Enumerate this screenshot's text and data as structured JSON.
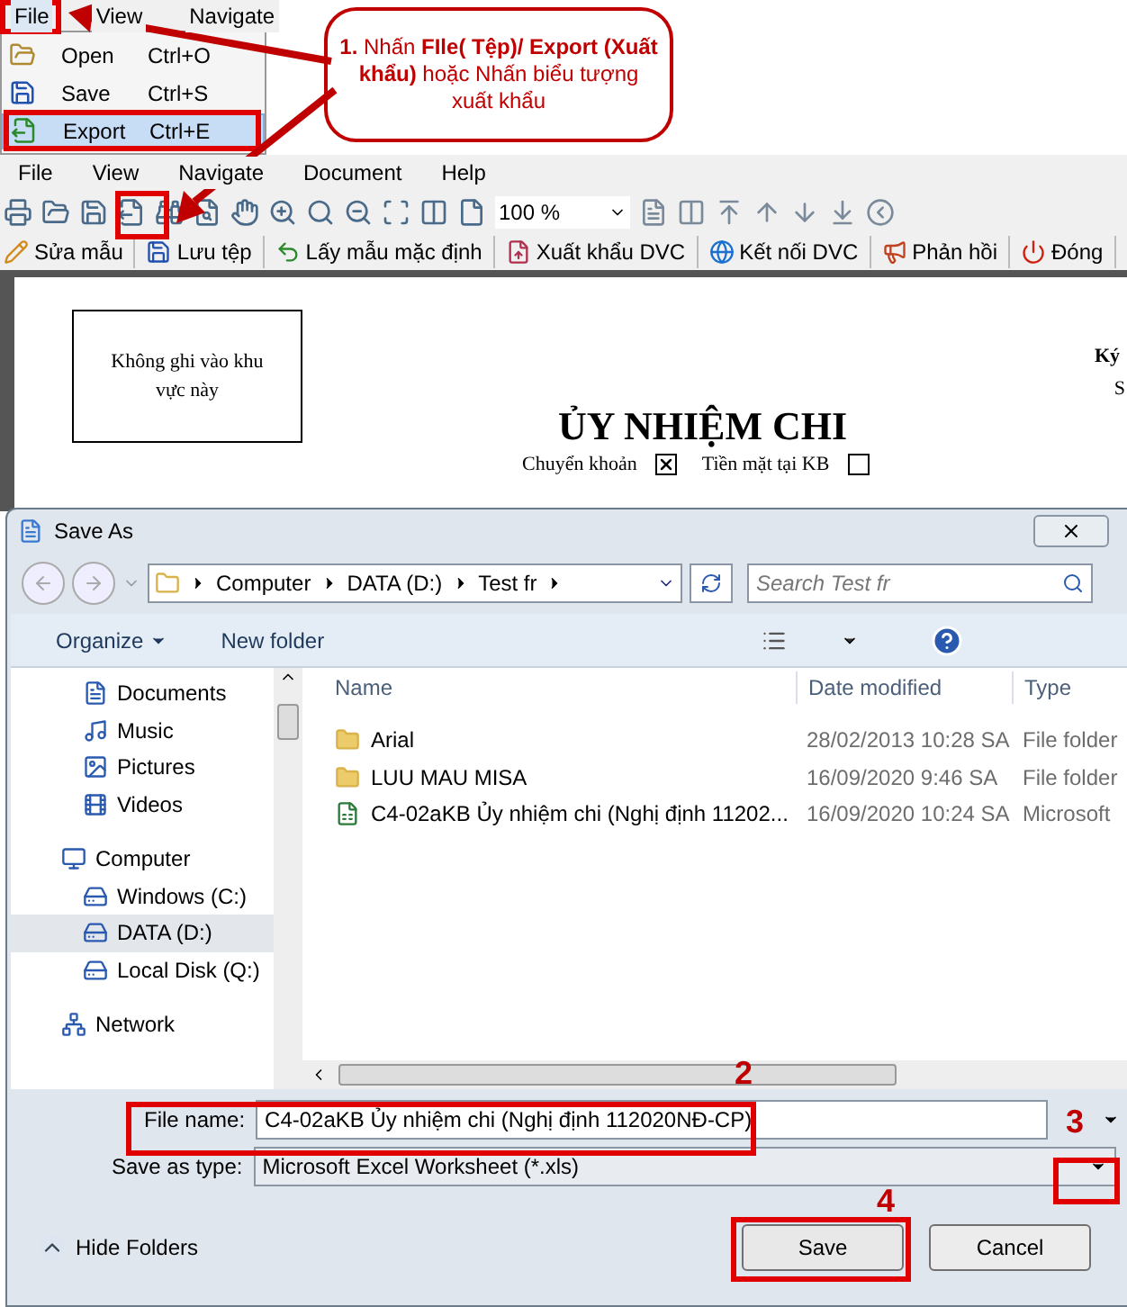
{
  "top_menu": {
    "items": [
      {
        "label": "File",
        "selected": true
      },
      {
        "label": "View",
        "selected": false
      },
      {
        "label": "Navigate",
        "selected": false
      }
    ],
    "dropdown": [
      {
        "label": "Open",
        "shortcut": "Ctrl+O",
        "selected": false
      },
      {
        "label": "Save",
        "shortcut": "Ctrl+S",
        "selected": false
      },
      {
        "label": "Export",
        "shortcut": "Ctrl+E",
        "selected": true
      }
    ]
  },
  "callout": "**1.** Nhấn **FIle( Tệp)/ Export (Xuất khẩu)** hoặc Nhấn biểu tượng xuất khẩu",
  "menu_bar": [
    "File",
    "View",
    "Navigate",
    "Document",
    "Help"
  ],
  "toolbar": {
    "zoom": "100 %"
  },
  "action_bar": [
    "Sửa mẫu",
    "Lưu tệp",
    "Lấy mẫu mặc định",
    "Xuất khẩu DVC",
    "Kết nối DVC",
    "Phản hồi",
    "Đóng"
  ],
  "document": {
    "note": "Không ghi vào khu vực này",
    "title": "ỦY NHIỆM CHI",
    "options": [
      {
        "label": "Chuyển khoản",
        "checked": true
      },
      {
        "label": "Tiền mặt tại KB",
        "checked": false
      }
    ],
    "right_texts": [
      "Ký",
      "S"
    ]
  },
  "dialog": {
    "title": "Save As",
    "breadcrumb": [
      "Computer",
      "DATA (D:)",
      "Test fr"
    ],
    "search": {
      "placeholder": "Search Test fr"
    },
    "commands": [
      "Organize",
      "New folder"
    ],
    "nav": [
      {
        "label": "Documents",
        "kind": "item",
        "selected": false
      },
      {
        "label": "Music",
        "kind": "item",
        "selected": false
      },
      {
        "label": "Pictures",
        "kind": "item",
        "selected": false
      },
      {
        "label": "Videos",
        "kind": "item",
        "selected": false
      },
      {
        "label": "Computer",
        "kind": "group",
        "selected": false
      },
      {
        "label": "Windows (C:)",
        "kind": "item",
        "selected": false
      },
      {
        "label": "DATA (D:)",
        "kind": "item",
        "selected": true
      },
      {
        "label": "Local Disk (Q:)",
        "kind": "item",
        "selected": false
      },
      {
        "label": "Network",
        "kind": "group",
        "selected": false
      }
    ],
    "columns": [
      "Name",
      "Date modified",
      "Type"
    ],
    "rows": [
      {
        "kind": "folder",
        "name": "Arial",
        "date": "28/02/2013 10:28 SA",
        "type": "File folder"
      },
      {
        "kind": "folder",
        "name": "LUU MAU MISA",
        "date": "16/09/2020 9:46 SA",
        "type": "File folder"
      },
      {
        "kind": "excel",
        "name": "C4-02aKB Ủy nhiệm chi (Nghị định 11202...",
        "date": "16/09/2020 10:24 SA",
        "type": "Microsoft"
      }
    ],
    "file_name": {
      "label": "File name:",
      "value": "C4-02aKB Ủy nhiệm chi (Nghị định 112020NĐ-CP)"
    },
    "save_type": {
      "label": "Save as type:",
      "value": "Microsoft Excel Worksheet (*.xls)"
    },
    "hide_folders": "Hide Folders",
    "buttons": [
      "Save",
      "Cancel"
    ]
  },
  "steps": [
    "2",
    "3",
    "4"
  ]
}
